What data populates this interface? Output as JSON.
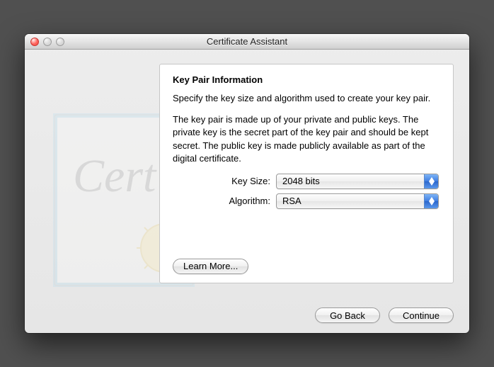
{
  "window": {
    "title": "Certificate Assistant"
  },
  "panel": {
    "heading": "Key Pair Information",
    "para1": "Specify the key size and algorithm used to create your key pair.",
    "para2": "The key pair is made up of your private and public keys. The private key is the secret part of the key pair and should be kept secret. The public key is made publicly available as part of the digital certificate.",
    "keysize_label": "Key Size:",
    "keysize_value": "2048 bits",
    "algorithm_label": "Algorithm:",
    "algorithm_value": "RSA",
    "learn_more": "Learn More..."
  },
  "footer": {
    "goback": "Go Back",
    "continue": "Continue"
  }
}
